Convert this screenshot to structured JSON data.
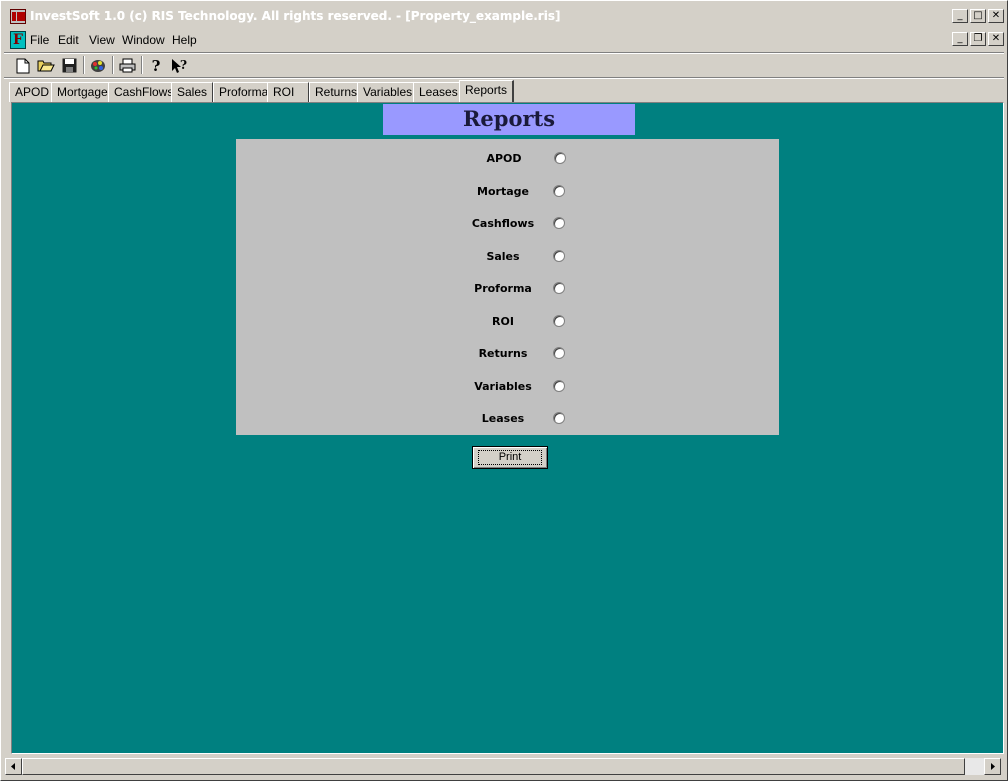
{
  "window": {
    "title": "InvestSoft 1.0 (c) RIS Technology. All rights reserved. - [Property_example.ris]",
    "app_icon_text": "RIS"
  },
  "menu": {
    "items": [
      {
        "label": "File"
      },
      {
        "label": "Edit"
      },
      {
        "label": "View"
      },
      {
        "label": "Window"
      },
      {
        "label": "Help"
      }
    ]
  },
  "toolbar": {
    "buttons": [
      "new-file-icon",
      "open-folder-icon",
      "save-disk-icon",
      "color-palette-icon",
      "print-icon",
      "help-icon",
      "context-help-icon"
    ]
  },
  "tabs": [
    {
      "label": "APOD"
    },
    {
      "label": "Mortgage"
    },
    {
      "label": "CashFlows"
    },
    {
      "label": "Sales"
    },
    {
      "label": "Proforma"
    },
    {
      "label": "ROI"
    },
    {
      "label": "Returns"
    },
    {
      "label": "Variables"
    },
    {
      "label": "Leases"
    },
    {
      "label": "Reports",
      "active": true
    }
  ],
  "reports": {
    "header": "Reports",
    "options": [
      {
        "label": "APOD",
        "selected": false
      },
      {
        "label": "Mortage",
        "selected": false
      },
      {
        "label": "Cashflows",
        "selected": false
      },
      {
        "label": "Sales",
        "selected": false
      },
      {
        "label": "Proforma",
        "selected": false
      },
      {
        "label": "ROI",
        "selected": false
      },
      {
        "label": "Returns",
        "selected": false
      },
      {
        "label": "Variables",
        "selected": false
      },
      {
        "label": "Leases",
        "selected": false
      }
    ],
    "print_label": "Print"
  },
  "colors": {
    "workspace": "#008080",
    "header_bg": "#9999ff",
    "panel_bg": "#c0c0c0",
    "chrome": "#d4d0c8"
  }
}
